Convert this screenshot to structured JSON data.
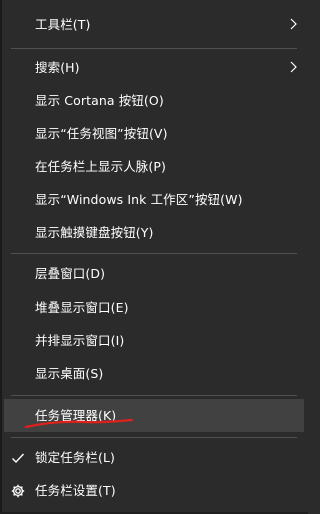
{
  "menu": {
    "toolbars": "工具栏(T)",
    "search": "搜索(H)",
    "show_cortana": "显示 Cortana 按钮(O)",
    "show_task_view": "显示“任务视图”按钮(V)",
    "show_people": "在任务栏上显示人脉(P)",
    "show_ink": "显示“Windows Ink 工作区”按钮(W)",
    "show_touch_keyboard": "显示触摸键盘按钮(Y)",
    "cascade": "层叠窗口(D)",
    "stacked": "堆叠显示窗口(E)",
    "side_by_side": "并排显示窗口(I)",
    "show_desktop": "显示桌面(S)",
    "task_manager": "任务管理器(K)",
    "lock_taskbar": "锁定任务栏(L)",
    "taskbar_settings": "任务栏设置(T)"
  },
  "icons": {
    "submenu": "chevron-right-icon",
    "check": "checkmark-icon",
    "settings": "gear-icon"
  },
  "colors": {
    "background": "#2b2b2b",
    "highlight": "#414141",
    "separator": "#505050",
    "annotation": "#e0201a"
  }
}
